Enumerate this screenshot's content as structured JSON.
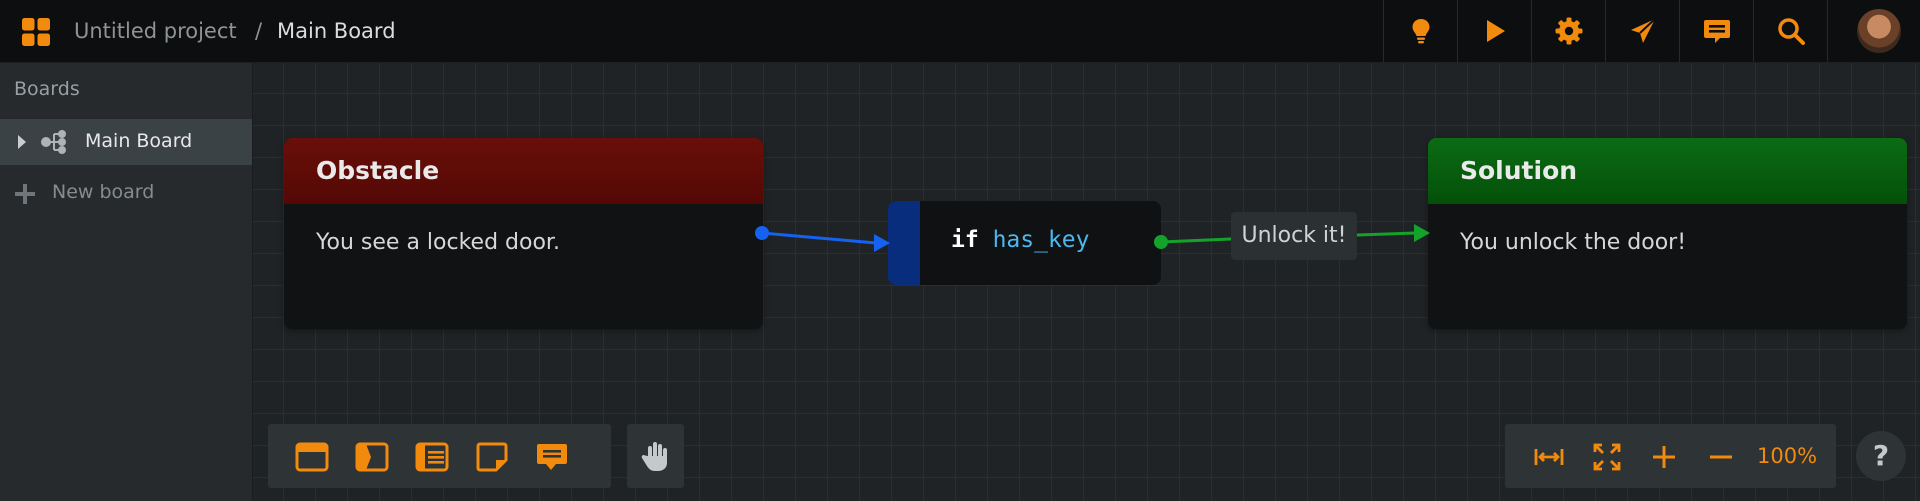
{
  "header": {
    "project_name": "Untitled project",
    "separator": "/",
    "board_name": "Main Board",
    "tools": [
      {
        "icon": "lightbulb-icon"
      },
      {
        "icon": "play-icon"
      },
      {
        "icon": "gear-icon"
      },
      {
        "icon": "paper-plane-icon"
      },
      {
        "icon": "comment-icon"
      },
      {
        "icon": "search-icon"
      }
    ],
    "accent": "#f28a0d"
  },
  "sidebar": {
    "title": "Boards",
    "items": [
      {
        "label": "Main Board",
        "icon": "board-tree-icon"
      }
    ],
    "new_board_label": "New board"
  },
  "canvas": {
    "nodes": {
      "obstacle": {
        "title": "Obstacle",
        "text": "You see a locked door.",
        "color": "#5f0c07"
      },
      "condition": {
        "keyword": "if",
        "variable": "has_key",
        "strip_color": "#082d7c"
      },
      "choice": {
        "label": "Unlock it!"
      },
      "solution": {
        "title": "Solution",
        "text": "You unlock the door!",
        "color": "#075e10"
      }
    },
    "link_colors": {
      "blue": "#1561f0",
      "green": "#14a32a"
    }
  },
  "bottom_toolbar": {
    "tools": [
      {
        "icon": "window-icon"
      },
      {
        "icon": "condition-node-icon"
      },
      {
        "icon": "list-icon"
      },
      {
        "icon": "sticky-note-icon"
      },
      {
        "icon": "comment-node-icon"
      }
    ],
    "hand_icon": "hand-icon"
  },
  "zoom": {
    "level": "100%",
    "tools": [
      {
        "icon": "fit-width-icon"
      },
      {
        "icon": "fullscreen-icon"
      },
      {
        "icon": "zoom-in-icon"
      },
      {
        "icon": "zoom-out-icon"
      }
    ]
  },
  "help": {
    "label": "?"
  }
}
